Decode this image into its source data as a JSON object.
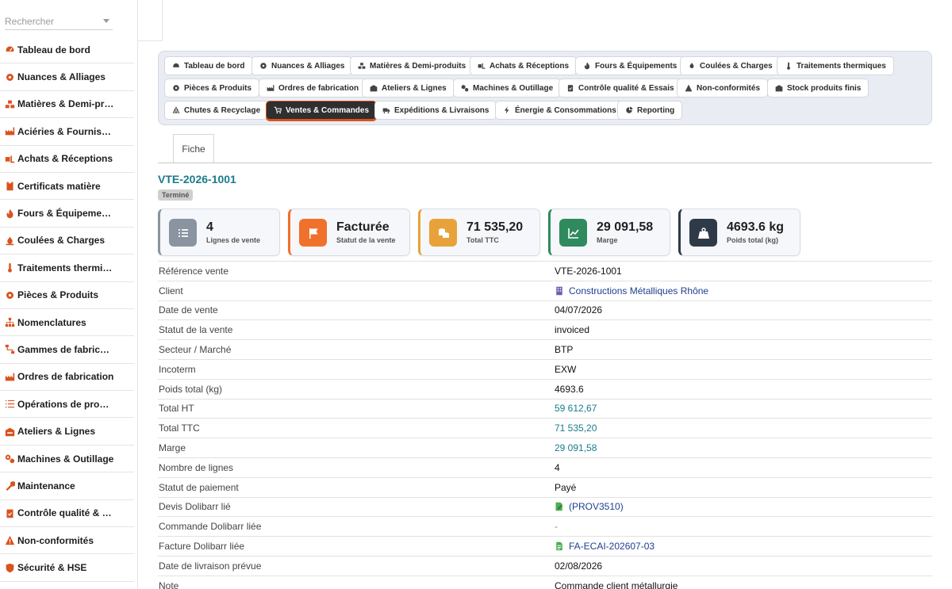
{
  "search": {
    "placeholder": "Rechercher"
  },
  "sidebar": {
    "items": [
      {
        "label": "Tableau de bord",
        "icon": "gauge-icon"
      },
      {
        "label": "Nuances & Alliages",
        "icon": "gear-icon"
      },
      {
        "label": "Matières & Demi-pro…",
        "icon": "cubes-icon"
      },
      {
        "label": "Aciéries & Fournisse…",
        "icon": "factory-icon"
      },
      {
        "label": "Achats & Réceptions",
        "icon": "truck-loading-icon"
      },
      {
        "label": "Certificats matière",
        "icon": "clipboard-icon"
      },
      {
        "label": "Fours & Équipements",
        "icon": "fire-icon"
      },
      {
        "label": "Coulées & Charges",
        "icon": "fire-burner-icon"
      },
      {
        "label": "Traitements thermiq…",
        "icon": "thermometer-icon"
      },
      {
        "label": "Pièces & Produits",
        "icon": "cog-icon"
      },
      {
        "label": "Nomenclatures",
        "icon": "sitemap-icon"
      },
      {
        "label": "Gammes de fabricati…",
        "icon": "diagram-icon"
      },
      {
        "label": "Ordres de fabrication",
        "icon": "industry-icon"
      },
      {
        "label": "Opérations de produ…",
        "icon": "list-icon"
      },
      {
        "label": "Ateliers & Lignes",
        "icon": "warehouse-icon"
      },
      {
        "label": "Machines & Outillage",
        "icon": "gears-icon"
      },
      {
        "label": "Maintenance",
        "icon": "wrench-icon"
      },
      {
        "label": "Contrôle qualité & E…",
        "icon": "clipboard-check-icon"
      },
      {
        "label": "Non-conformités",
        "icon": "warning-icon"
      },
      {
        "label": "Sécurité & HSE",
        "icon": "shield-icon"
      }
    ]
  },
  "tabs": [
    {
      "label": "Tableau de bord",
      "icon": "gauge-icon"
    },
    {
      "label": "Nuances & Alliages",
      "icon": "gear-icon"
    },
    {
      "label": "Matières & Demi-produits",
      "icon": "cubes-icon"
    },
    {
      "label": "Achats & Réceptions",
      "icon": "truck-loading-icon"
    },
    {
      "label": "Fours & Équipements",
      "icon": "fire-icon"
    },
    {
      "label": "Coulées & Charges",
      "icon": "fire-burner-icon"
    },
    {
      "label": "Traitements thermiques",
      "icon": "thermometer-icon"
    },
    {
      "label": "Pièces & Produits",
      "icon": "cog-icon"
    },
    {
      "label": "Ordres de fabrication",
      "icon": "industry-icon"
    },
    {
      "label": "Ateliers & Lignes",
      "icon": "warehouse-icon"
    },
    {
      "label": "Machines & Outillage",
      "icon": "gears-icon"
    },
    {
      "label": "Contrôle qualité & Essais",
      "icon": "clipboard-check-icon"
    },
    {
      "label": "Non-conformités",
      "icon": "warning-icon"
    },
    {
      "label": "Stock produits finis",
      "icon": "warehouse-icon"
    },
    {
      "label": "Chutes & Recyclage",
      "icon": "recycle-icon"
    },
    {
      "label": "Ventes & Commandes",
      "icon": "cart-icon",
      "active": true
    },
    {
      "label": "Expéditions & Livraisons",
      "icon": "truck-icon"
    },
    {
      "label": "Énergie & Consommations",
      "icon": "bolt-icon"
    },
    {
      "label": "Reporting",
      "icon": "chart-pie-icon"
    }
  ],
  "fiche_tab": "Fiche",
  "record": {
    "ref": "VTE-2026-1001",
    "status_badge": "Terminé"
  },
  "kpis": [
    {
      "value": "4",
      "label": "Lignes de vente",
      "icon": "list-icon",
      "color": "#8a93a0"
    },
    {
      "value": "Facturée",
      "label": "Statut de la vente",
      "icon": "flag-icon",
      "color": "#f0712b"
    },
    {
      "value": "71 535,20",
      "label": "Total TTC",
      "icon": "coins-icon",
      "color": "#e8a23a"
    },
    {
      "value": "29 091,58",
      "label": "Marge",
      "icon": "chart-line-icon",
      "color": "#2f8a5e"
    },
    {
      "value": "4693.6 kg",
      "label": "Poids total (kg)",
      "icon": "weight-icon",
      "color": "#2f3a48"
    }
  ],
  "details": [
    {
      "key": "Référence vente",
      "value": "VTE-2026-1001"
    },
    {
      "key": "Client",
      "value": "Constructions Métalliques Rhône",
      "icon": "building-icon"
    },
    {
      "key": "Date de vente",
      "value": "04/07/2026"
    },
    {
      "key": "Statut de la vente",
      "value": "invoiced"
    },
    {
      "key": "Secteur / Marché",
      "value": "BTP"
    },
    {
      "key": "Incoterm",
      "value": "EXW"
    },
    {
      "key": "Poids total (kg)",
      "value": "4693.6"
    },
    {
      "key": "Total HT",
      "value": "59 612,67"
    },
    {
      "key": "Total TTC",
      "value": "71 535,20"
    },
    {
      "key": "Marge",
      "value": "29 091,58"
    },
    {
      "key": "Nombre de lignes",
      "value": "4"
    },
    {
      "key": "Statut de paiement",
      "value": "Payé"
    },
    {
      "key": "Devis Dolibarr lié",
      "value": "(PROV3510)",
      "icon": "file-signature-icon"
    },
    {
      "key": "Commande Dolibarr liée",
      "value": "-"
    },
    {
      "key": "Facture Dolibarr liée",
      "value": "FA-ECAI-202607-03",
      "icon": "file-invoice-icon"
    },
    {
      "key": "Date de livraison prévue",
      "value": "02/08/2026"
    },
    {
      "key": "Note",
      "value": "Commande client métallurgie"
    }
  ],
  "colors": {
    "accent": "#d9531e",
    "teal": "#1a7b8b",
    "link": "#1f3f8f"
  }
}
